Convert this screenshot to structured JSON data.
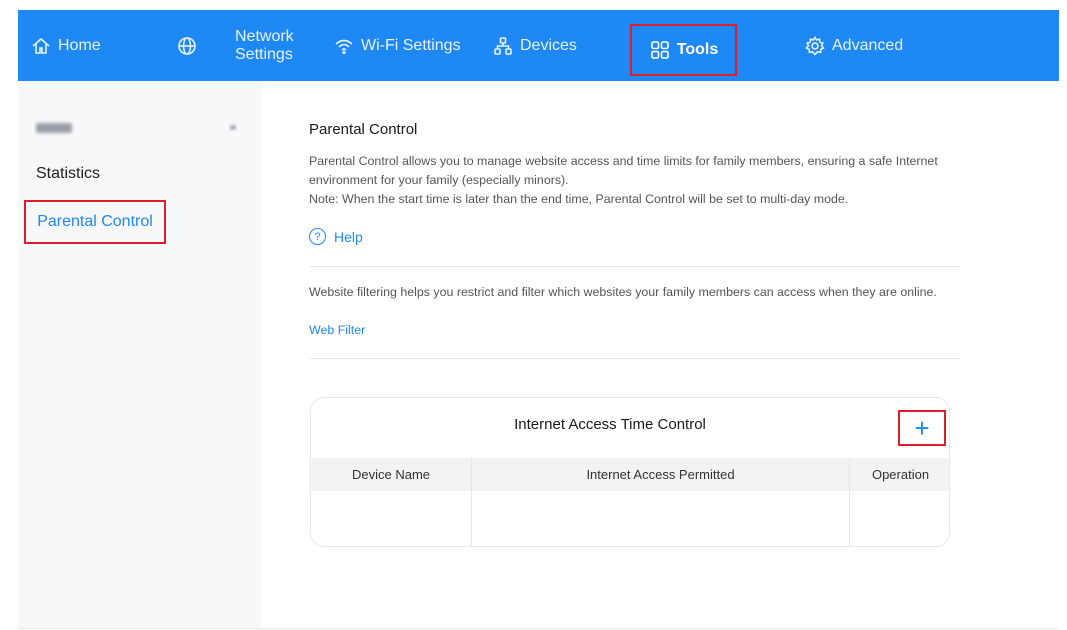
{
  "nav": {
    "home": "Home",
    "network_line1": "Network",
    "network_line2": "Settings",
    "wifi": "Wi-Fi Settings",
    "devices": "Devices",
    "tools": "Tools",
    "advanced": "Advanced",
    "icons": [
      "home-icon",
      "globe-icon",
      "wifi-icon",
      "devices-icon",
      "tools-grid-icon",
      "gear-icon"
    ]
  },
  "sidebar": {
    "items": [
      {
        "label": "Statistics"
      },
      {
        "label": "Parental Control",
        "active": true
      }
    ]
  },
  "main": {
    "title": "Parental Control",
    "description": "Parental Control allows you to manage website access and time limits for family members, ensuring a safe Internet environment for your family (especially minors).",
    "note": "Note: When the start time is later than the end time, Parental Control will be set to multi-day mode.",
    "help": "Help",
    "filter_description": "Website filtering helps you restrict and filter which websites your family members can access when they are online.",
    "web_filter": "Web Filter"
  },
  "time_control": {
    "title": "Internet Access Time Control",
    "add_symbol": "+",
    "columns": [
      "Device Name",
      "Internet Access Permitted",
      "Operation"
    ]
  },
  "colors": {
    "accent": "#1e88f5",
    "highlight_box": "#e11d2a"
  }
}
